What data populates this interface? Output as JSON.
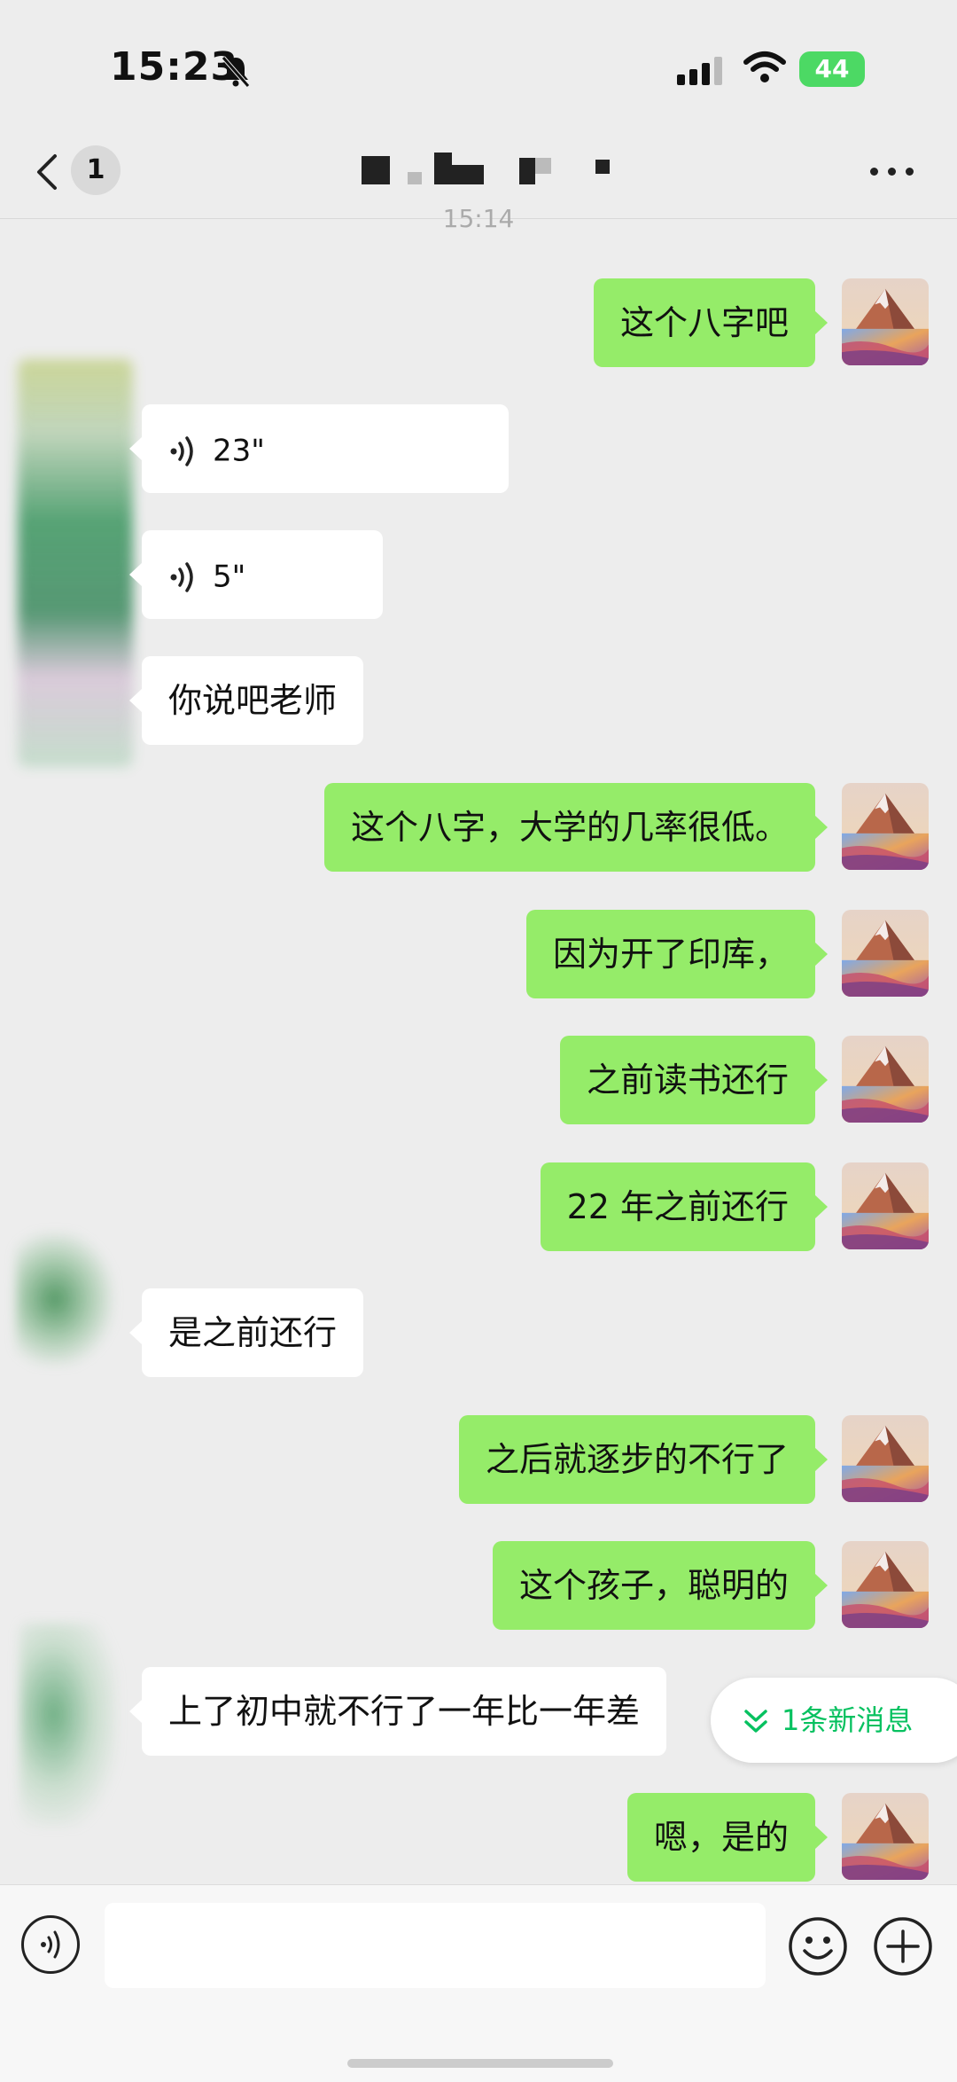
{
  "status_bar": {
    "time": "15:23",
    "battery": "44"
  },
  "header": {
    "unread_count": "1"
  },
  "timestamp": "15:14",
  "messages": [
    {
      "side": "sent",
      "text": "这个八字吧"
    },
    {
      "side": "received",
      "type": "voice",
      "duration": "23\""
    },
    {
      "side": "received",
      "type": "voice",
      "duration": "5\""
    },
    {
      "side": "received",
      "text": "你说吧老师"
    },
    {
      "side": "sent",
      "text": "这个八字，大学的几率很低。"
    },
    {
      "side": "sent",
      "text": "因为开了印库，"
    },
    {
      "side": "sent",
      "text": "之前读书还行"
    },
    {
      "side": "sent",
      "text": "22 年之前还行"
    },
    {
      "side": "received",
      "text": "是之前还行"
    },
    {
      "side": "sent",
      "text": "之后就逐步的不行了"
    },
    {
      "side": "sent",
      "text": "这个孩子，聪明的"
    },
    {
      "side": "received",
      "text": "上了初中就不行了一年比一年差"
    },
    {
      "side": "sent",
      "text": "嗯，是的"
    }
  ],
  "new_message_pill": "1条新消息",
  "input": {
    "value": "",
    "placeholder": ""
  },
  "colors": {
    "sent_bubble": "#95ec69",
    "received_bubble": "#ffffff",
    "background": "#ededed",
    "accent": "#07c160"
  }
}
